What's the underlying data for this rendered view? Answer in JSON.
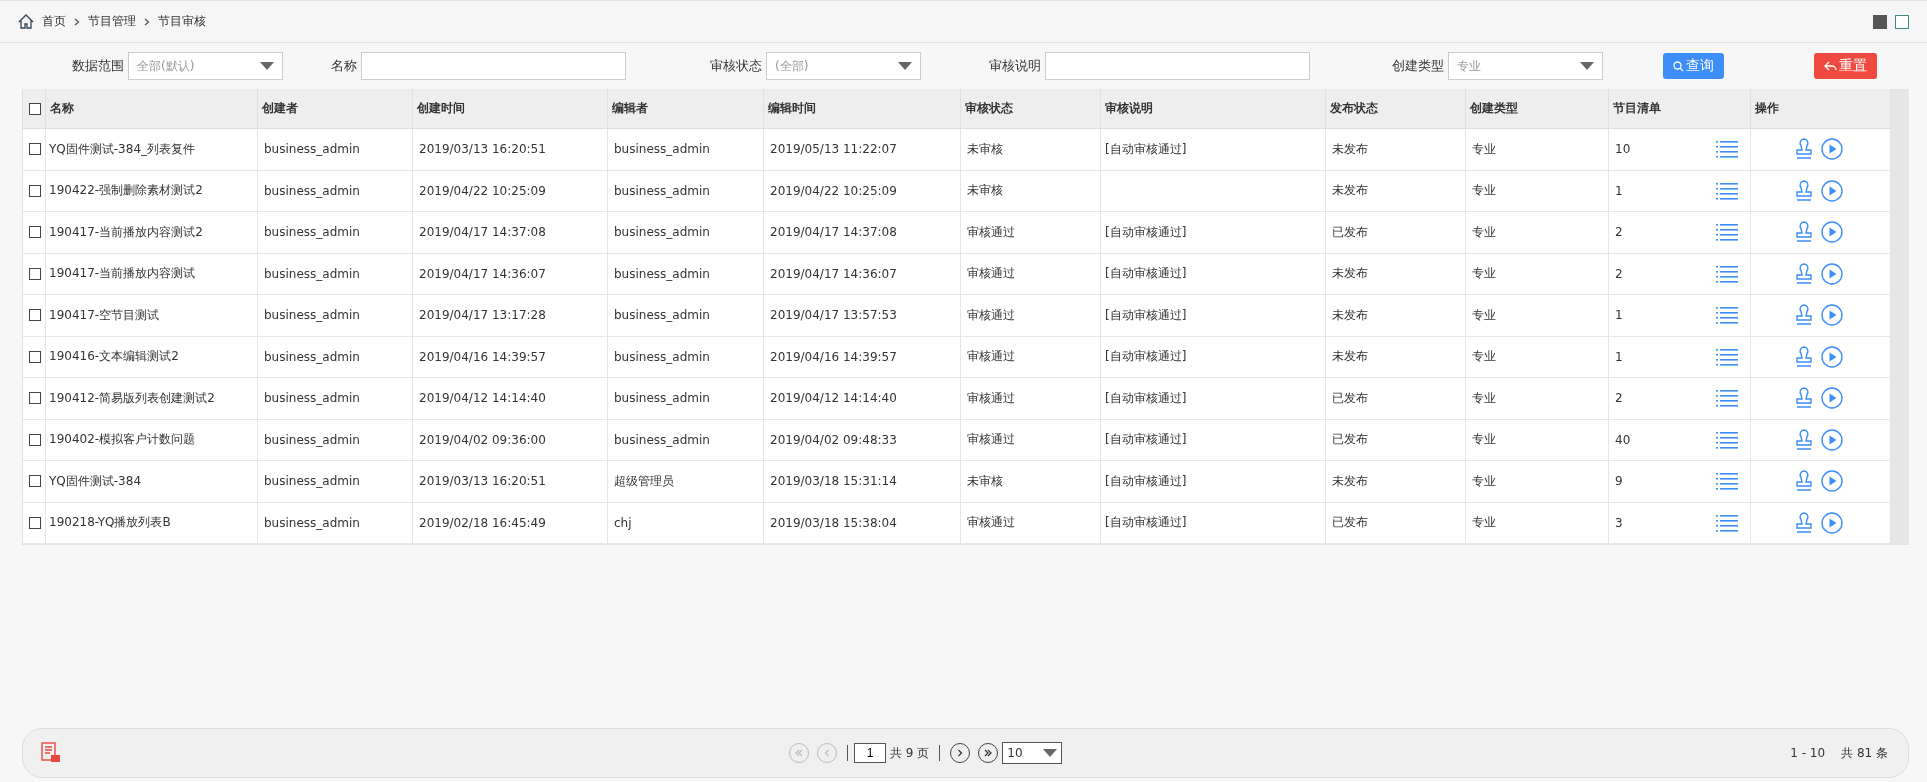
{
  "breadcrumb": [
    "首页",
    "节目管理",
    "节目审核"
  ],
  "filters": [
    {
      "kind": "select",
      "label": "数据范围",
      "value": "全部(默认)"
    },
    {
      "kind": "text",
      "label": "名称"
    },
    {
      "kind": "select",
      "label": "审核状态",
      "value": "(全部)"
    },
    {
      "kind": "text",
      "label": "审核说明"
    },
    {
      "kind": "select",
      "label": "创建类型",
      "value": "专业"
    }
  ],
  "buttons": [
    {
      "kind": "search",
      "label": "查询"
    },
    {
      "kind": "reset",
      "label": "重置"
    }
  ],
  "table": {
    "select_all_checked": false,
    "columns": [
      "名称",
      "创建者",
      "创建时间",
      "编辑者",
      "编辑时间",
      "审核状态",
      "审核说明",
      "发布状态",
      "创建类型",
      "节目清单",
      "操作"
    ],
    "rows": [
      {
        "checked": false,
        "cells": [
          "YQ固件测试-384_列表复件",
          "business_admin",
          "2019/03/13 16:20:51",
          "business_admin",
          "2019/05/13 11:22:07",
          "未审核",
          "[自动审核通过]",
          "未发布",
          "专业",
          "10"
        ]
      },
      {
        "checked": false,
        "cells": [
          "190422-强制删除素材测试2",
          "business_admin",
          "2019/04/22 10:25:09",
          "business_admin",
          "2019/04/22 10:25:09",
          "未审核",
          "",
          "未发布",
          "专业",
          "1"
        ]
      },
      {
        "checked": false,
        "cells": [
          "190417-当前播放内容测试2",
          "business_admin",
          "2019/04/17 14:37:08",
          "business_admin",
          "2019/04/17 14:37:08",
          "审核通过",
          "[自动审核通过]",
          "已发布",
          "专业",
          "2"
        ]
      },
      {
        "checked": false,
        "cells": [
          "190417-当前播放内容测试",
          "business_admin",
          "2019/04/17 14:36:07",
          "business_admin",
          "2019/04/17 14:36:07",
          "审核通过",
          "[自动审核通过]",
          "未发布",
          "专业",
          "2"
        ]
      },
      {
        "checked": false,
        "cells": [
          "190417-空节目测试",
          "business_admin",
          "2019/04/17 13:17:28",
          "business_admin",
          "2019/04/17 13:57:53",
          "审核通过",
          "[自动审核通过]",
          "未发布",
          "专业",
          "1"
        ]
      },
      {
        "checked": false,
        "cells": [
          "190416-文本编辑测试2",
          "business_admin",
          "2019/04/16 14:39:57",
          "business_admin",
          "2019/04/16 14:39:57",
          "审核通过",
          "[自动审核通过]",
          "未发布",
          "专业",
          "1"
        ]
      },
      {
        "checked": false,
        "cells": [
          "190412-简易版列表创建测试2",
          "business_admin",
          "2019/04/12 14:14:40",
          "business_admin",
          "2019/04/12 14:14:40",
          "审核通过",
          "[自动审核通过]",
          "已发布",
          "专业",
          "2"
        ]
      },
      {
        "checked": false,
        "cells": [
          "190402-模拟客户计数问题",
          "business_admin",
          "2019/04/02 09:36:00",
          "business_admin",
          "2019/04/02 09:48:33",
          "审核通过",
          "[自动审核通过]",
          "已发布",
          "专业",
          "40"
        ]
      },
      {
        "checked": false,
        "cells": [
          "YQ固件测试-384",
          "business_admin",
          "2019/03/13 16:20:51",
          "超级管理员",
          "2019/03/18 15:31:14",
          "未审核",
          "[自动审核通过]",
          "未发布",
          "专业",
          "9"
        ]
      },
      {
        "checked": false,
        "cells": [
          "190218-YQ播放列表B",
          "business_admin",
          "2019/02/18 16:45:49",
          "chj",
          "2019/03/18 15:38:04",
          "审核通过",
          "[自动审核通过]",
          "已发布",
          "专业",
          "3"
        ]
      }
    ]
  },
  "pager": {
    "first_disabled": true,
    "prev_disabled": true,
    "page": "1",
    "total_pages": "共 9 页",
    "page_size": "10",
    "range": "1 - 10",
    "total": "共 81 条"
  }
}
